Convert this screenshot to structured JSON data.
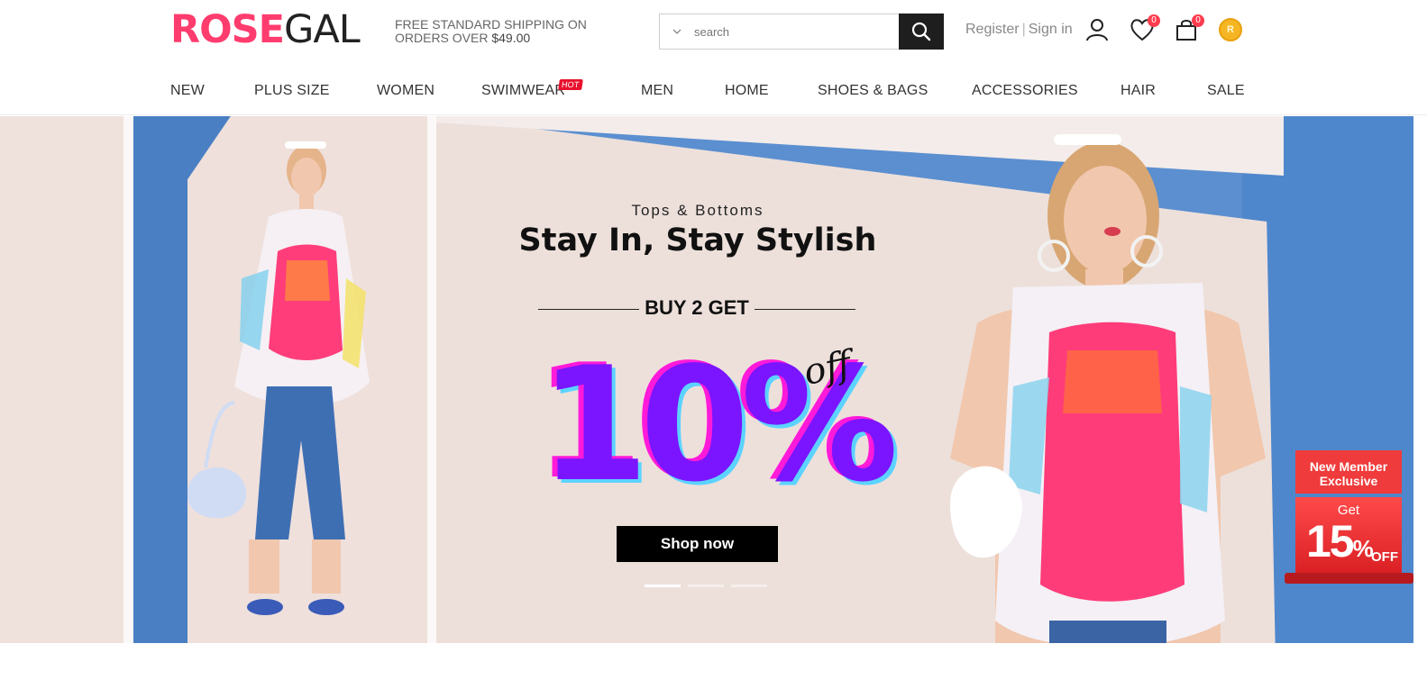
{
  "brand": {
    "part1": "ROSE",
    "part2": "GAL"
  },
  "header": {
    "shipping_text": "FREE STANDARD SHIPPING ON ORDERS OVER",
    "shipping_amount": "$49.00",
    "search_placeholder": "search",
    "register": "Register",
    "separator": "|",
    "sign_in": "Sign in",
    "wishlist_count": "0",
    "cart_count": "0",
    "coin_letter": "R"
  },
  "nav": {
    "items": [
      "NEW",
      "PLUS SIZE",
      "WOMEN",
      "SWIMWEAR",
      "MEN",
      "HOME",
      "SHOES & BAGS",
      "ACCESSORIES",
      "HAIR",
      "SALE"
    ],
    "hot_label": "HOT"
  },
  "banner": {
    "kicker": "Tops & Bottoms",
    "headline": "Stay In, Stay Stylish",
    "buy_text": "BUY 2 GET",
    "discount": "10%",
    "off": "off",
    "cta": "Shop now",
    "slides": 3,
    "active_slide": 1
  },
  "member_offer": {
    "title_line1": "New Member",
    "title_line2": "Exclusive",
    "get": "Get",
    "percent": "15",
    "percent_sign": "%",
    "off": "OFF"
  },
  "colors": {
    "brand_pink": "#ff3c6e",
    "badge_red": "#ff3c4e",
    "discount_purple": "#7b14ff",
    "discount_magenta": "#ff1ad9",
    "discount_cyan": "#5cd3ff",
    "offer_red": "#ef3b3b"
  },
  "icons": [
    "chevron-down-icon",
    "search-icon",
    "user-icon",
    "heart-icon",
    "bag-icon",
    "coin-icon"
  ]
}
